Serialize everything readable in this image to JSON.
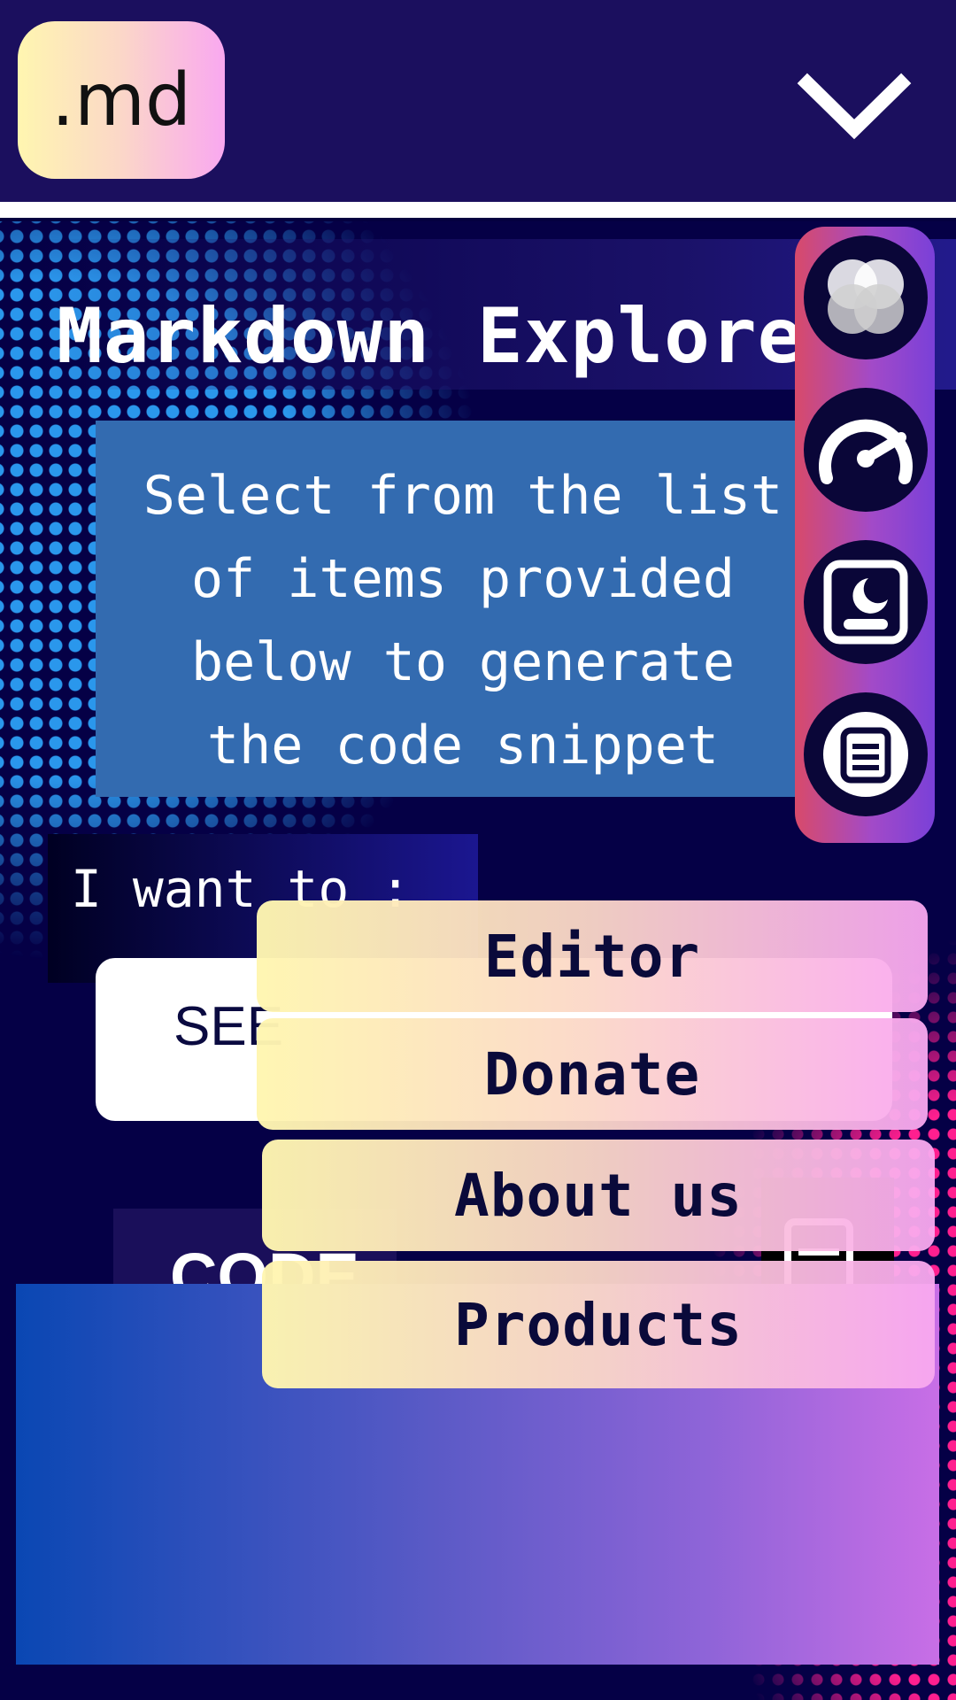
{
  "header": {
    "logo_text": ".md",
    "menu_toggle_icon": "chevron-down-icon"
  },
  "main": {
    "title": "Markdown Explorer",
    "intro_text": "Select from the list\nof items provided\nbelow to generate\nthe code snippet",
    "want_label": "I want to :",
    "select_value": "SEE",
    "code_label": "CODE"
  },
  "side_menu": [
    {
      "icon": "color-circles-icon"
    },
    {
      "icon": "speedometer-icon"
    },
    {
      "icon": "dark-mode-toggle-icon"
    },
    {
      "icon": "document-icon"
    }
  ],
  "dropdown": {
    "items": [
      "Editor",
      "Donate",
      "About us",
      "Products"
    ]
  },
  "colors": {
    "header_bg": "#1b0f5e",
    "page_bg": "#050046",
    "accent_yellow": "#fff6b0",
    "accent_pink": "#f9a8f0",
    "intro_bg": "#336bb0"
  }
}
